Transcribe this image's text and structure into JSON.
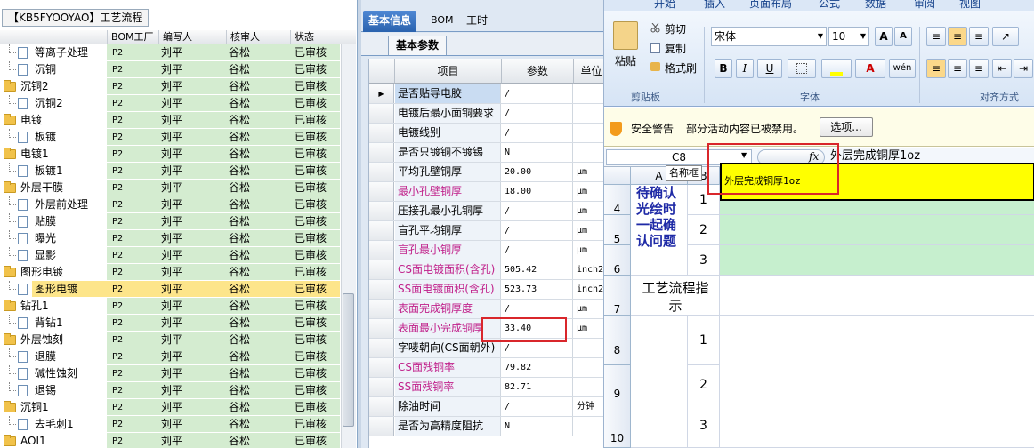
{
  "left_panel": {
    "title": "【KB5FYOOYAO】工艺流程",
    "columns": [
      "BOM工厂",
      "编写人",
      "核审人",
      "状态"
    ],
    "rows": [
      {
        "name": "等离子处理",
        "level": 2,
        "type": "doc",
        "factory": "P2",
        "writer": "刘平",
        "reviewer": "谷松",
        "status": "已审核"
      },
      {
        "name": "沉铜",
        "level": 2,
        "type": "doc",
        "factory": "P2",
        "writer": "刘平",
        "reviewer": "谷松",
        "status": "已审核"
      },
      {
        "name": "沉铜2",
        "level": 1,
        "type": "folder",
        "factory": "P2",
        "writer": "刘平",
        "reviewer": "谷松",
        "status": "已审核"
      },
      {
        "name": "沉铜2",
        "level": 2,
        "type": "doc",
        "factory": "P2",
        "writer": "刘平",
        "reviewer": "谷松",
        "status": "已审核"
      },
      {
        "name": "电镀",
        "level": 1,
        "type": "folder",
        "factory": "P2",
        "writer": "刘平",
        "reviewer": "谷松",
        "status": "已审核"
      },
      {
        "name": "板镀",
        "level": 2,
        "type": "doc",
        "factory": "P2",
        "writer": "刘平",
        "reviewer": "谷松",
        "status": "已审核"
      },
      {
        "name": "电镀1",
        "level": 1,
        "type": "folder",
        "factory": "P2",
        "writer": "刘平",
        "reviewer": "谷松",
        "status": "已审核"
      },
      {
        "name": "板镀1",
        "level": 2,
        "type": "doc",
        "factory": "P2",
        "writer": "刘平",
        "reviewer": "谷松",
        "status": "已审核"
      },
      {
        "name": "外层干膜",
        "level": 1,
        "type": "folder",
        "factory": "P2",
        "writer": "刘平",
        "reviewer": "谷松",
        "status": "已审核"
      },
      {
        "name": "外层前处理",
        "level": 2,
        "type": "doc",
        "factory": "P2",
        "writer": "刘平",
        "reviewer": "谷松",
        "status": "已审核"
      },
      {
        "name": "贴膜",
        "level": 2,
        "type": "doc",
        "factory": "P2",
        "writer": "刘平",
        "reviewer": "谷松",
        "status": "已审核"
      },
      {
        "name": "曝光",
        "level": 2,
        "type": "doc",
        "factory": "P2",
        "writer": "刘平",
        "reviewer": "谷松",
        "status": "已审核"
      },
      {
        "name": "显影",
        "level": 2,
        "type": "doc",
        "factory": "P2",
        "writer": "刘平",
        "reviewer": "谷松",
        "status": "已审核"
      },
      {
        "name": "图形电镀",
        "level": 1,
        "type": "folder",
        "factory": "P2",
        "writer": "刘平",
        "reviewer": "谷松",
        "status": "已审核"
      },
      {
        "name": "图形电镀",
        "level": 2,
        "type": "doc",
        "factory": "P2",
        "writer": "刘平",
        "reviewer": "谷松",
        "status": "已审核",
        "selected": true
      },
      {
        "name": "钻孔1",
        "level": 1,
        "type": "folder",
        "factory": "P2",
        "writer": "刘平",
        "reviewer": "谷松",
        "status": "已审核"
      },
      {
        "name": "背钻1",
        "level": 2,
        "type": "doc",
        "factory": "P2",
        "writer": "刘平",
        "reviewer": "谷松",
        "status": "已审核"
      },
      {
        "name": "外层蚀刻",
        "level": 1,
        "type": "folder",
        "factory": "P2",
        "writer": "刘平",
        "reviewer": "谷松",
        "status": "已审核"
      },
      {
        "name": "退膜",
        "level": 2,
        "type": "doc",
        "factory": "P2",
        "writer": "刘平",
        "reviewer": "谷松",
        "status": "已审核"
      },
      {
        "name": "碱性蚀刻",
        "level": 2,
        "type": "doc",
        "factory": "P2",
        "writer": "刘平",
        "reviewer": "谷松",
        "status": "已审核"
      },
      {
        "name": "退锡",
        "level": 2,
        "type": "doc",
        "factory": "P2",
        "writer": "刘平",
        "reviewer": "谷松",
        "status": "已审核"
      },
      {
        "name": "沉铜1",
        "level": 1,
        "type": "folder",
        "factory": "P2",
        "writer": "刘平",
        "reviewer": "谷松",
        "status": "已审核"
      },
      {
        "name": "去毛刺1",
        "level": 2,
        "type": "doc",
        "factory": "P2",
        "writer": "刘平",
        "reviewer": "谷松",
        "status": "已审核"
      },
      {
        "name": "AOI1",
        "level": 1,
        "type": "folder",
        "factory": "P2",
        "writer": "刘平",
        "reviewer": "谷松",
        "status": "已审核"
      }
    ]
  },
  "middle_panel": {
    "tabs": [
      "基本信息",
      "BOM",
      "工时"
    ],
    "active_tab": "基本信息",
    "sub_tab": "基本参数",
    "columns": [
      "项目",
      "参数",
      "单位"
    ],
    "rows": [
      {
        "name": "是否贴导电胶",
        "value": "/",
        "unit": "",
        "pink": false,
        "current": true
      },
      {
        "name": "电镀后最小面铜要求",
        "value": "/",
        "unit": "",
        "pink": false
      },
      {
        "name": "电镀线别",
        "value": "/",
        "unit": "",
        "pink": false
      },
      {
        "name": "是否只镀铜不镀锡",
        "value": "N",
        "unit": "",
        "pink": false
      },
      {
        "name": "平均孔壁铜厚",
        "value": "20.00",
        "unit": "μm",
        "pink": false
      },
      {
        "name": "最小孔壁铜厚",
        "value": "18.00",
        "unit": "μm",
        "pink": true
      },
      {
        "name": "压接孔最小孔铜厚",
        "value": "/",
        "unit": "μm",
        "pink": false
      },
      {
        "name": "盲孔平均铜厚",
        "value": "/",
        "unit": "μm",
        "pink": false
      },
      {
        "name": "盲孔最小铜厚",
        "value": "/",
        "unit": "μm",
        "pink": true
      },
      {
        "name": "CS面电镀面积(含孔)",
        "value": "505.42",
        "unit": "inch2",
        "pink": true
      },
      {
        "name": "SS面电镀面积(含孔)",
        "value": "523.73",
        "unit": "inch2",
        "pink": true
      },
      {
        "name": "表面完成铜厚度",
        "value": "/",
        "unit": "μm",
        "pink": true
      },
      {
        "name": "表面最小完成铜厚",
        "value": "33.40",
        "unit": "μm",
        "pink": true
      },
      {
        "name": "字唛朝向(CS面朝外)",
        "value": "/",
        "unit": "",
        "pink": false
      },
      {
        "name": "CS面残铜率",
        "value": "79.82",
        "unit": "",
        "pink": true
      },
      {
        "name": "SS面残铜率",
        "value": "82.71",
        "unit": "",
        "pink": true
      },
      {
        "name": "除油时间",
        "value": "/",
        "unit": "分钟",
        "pink": false
      },
      {
        "name": "是否为高精度阻抗",
        "value": "N",
        "unit": "",
        "pink": false
      }
    ]
  },
  "excel": {
    "tabs": [
      "开始",
      "插入",
      "页面布局",
      "公式",
      "数据",
      "审阅",
      "视图"
    ],
    "clipboard": {
      "paste": "粘贴",
      "cut": "剪切",
      "copy": "复制",
      "format_painter": "格式刷",
      "label": "剪贴板"
    },
    "font": {
      "name": "宋体",
      "size": "10",
      "label": "字体",
      "bold": "B",
      "italic": "I",
      "underline": "U",
      "grow": "A",
      "shrink": "A",
      "color_letter": "A",
      "wen": "wén"
    },
    "alignment_label": "对齐方式",
    "security": {
      "title": "安全警告",
      "message": "部分活动内容已被禁用。",
      "button": "选项..."
    },
    "formula_bar": {
      "cell_ref": "C8",
      "fx": "fx",
      "content": "外层完成铜厚1oz"
    },
    "tooltip": "名称框",
    "column_headers": [
      "A",
      "B",
      "C",
      "D",
      "E"
    ],
    "row_headers": [
      "4",
      "5",
      "6",
      "7",
      "8",
      "9",
      "10"
    ],
    "cells": {
      "a_merged_4_6": "待确认光绘时一起确认问题",
      "b4": "1",
      "b5": "2",
      "b6": "3",
      "a7": "工艺流程指示",
      "b8": "1",
      "b9": "2",
      "b10": "3",
      "c8": "外层完成铜厚1oz"
    },
    "colors": {
      "green_fill": "#c6efce",
      "yellow_fill": "#ffff00",
      "blue_text": "#1f2aa6"
    }
  }
}
